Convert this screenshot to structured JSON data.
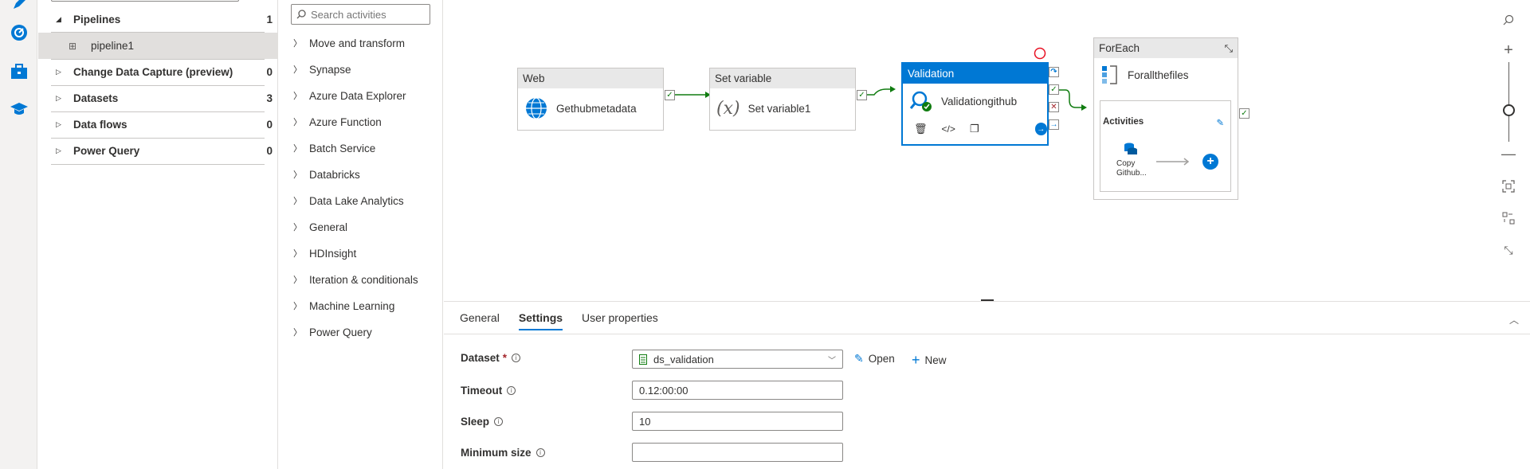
{
  "rail": {
    "icons": [
      "pencil-icon",
      "monitor-icon",
      "toolbox-icon",
      "learn-icon"
    ]
  },
  "resources": {
    "items": [
      {
        "label": "Pipelines",
        "count": "1",
        "expanded": true
      },
      {
        "label": "pipeline1",
        "count": "",
        "child": true
      },
      {
        "label": "Change Data Capture (preview)",
        "count": "0"
      },
      {
        "label": "Datasets",
        "count": "3"
      },
      {
        "label": "Data flows",
        "count": "0"
      },
      {
        "label": "Power Query",
        "count": "0"
      }
    ]
  },
  "activities": {
    "search_placeholder": "Search activities",
    "items": [
      "Move and transform",
      "Synapse",
      "Azure Data Explorer",
      "Azure Function",
      "Batch Service",
      "Databricks",
      "Data Lake Analytics",
      "General",
      "HDInsight",
      "Iteration & conditionals",
      "Machine Learning",
      "Power Query"
    ]
  },
  "canvas": {
    "nodes": {
      "web": {
        "type": "Web",
        "name": "Gethubmetadata"
      },
      "setvar": {
        "type": "Set variable",
        "name": "Set variable1"
      },
      "validation": {
        "type": "Validation",
        "name": "Validationgithub"
      },
      "foreach": {
        "type": "ForEach",
        "name": "Forallthefiles",
        "inner_title": "Activities",
        "inner_activity": "Copy Github..."
      }
    }
  },
  "bottom": {
    "tabs": [
      "General",
      "Settings",
      "User properties"
    ],
    "active_tab": "Settings",
    "fields": {
      "dataset_label": "Dataset",
      "dataset_required": "*",
      "dataset_value": "ds_validation",
      "open_label": "Open",
      "new_label": "New",
      "timeout_label": "Timeout",
      "timeout_value": "0.12:00:00",
      "sleep_label": "Sleep",
      "sleep_value": "10",
      "minsize_label": "Minimum size",
      "minsize_value": ""
    }
  },
  "colors": {
    "accent": "#0078d4",
    "success": "#107c10",
    "error": "#a4262c"
  }
}
